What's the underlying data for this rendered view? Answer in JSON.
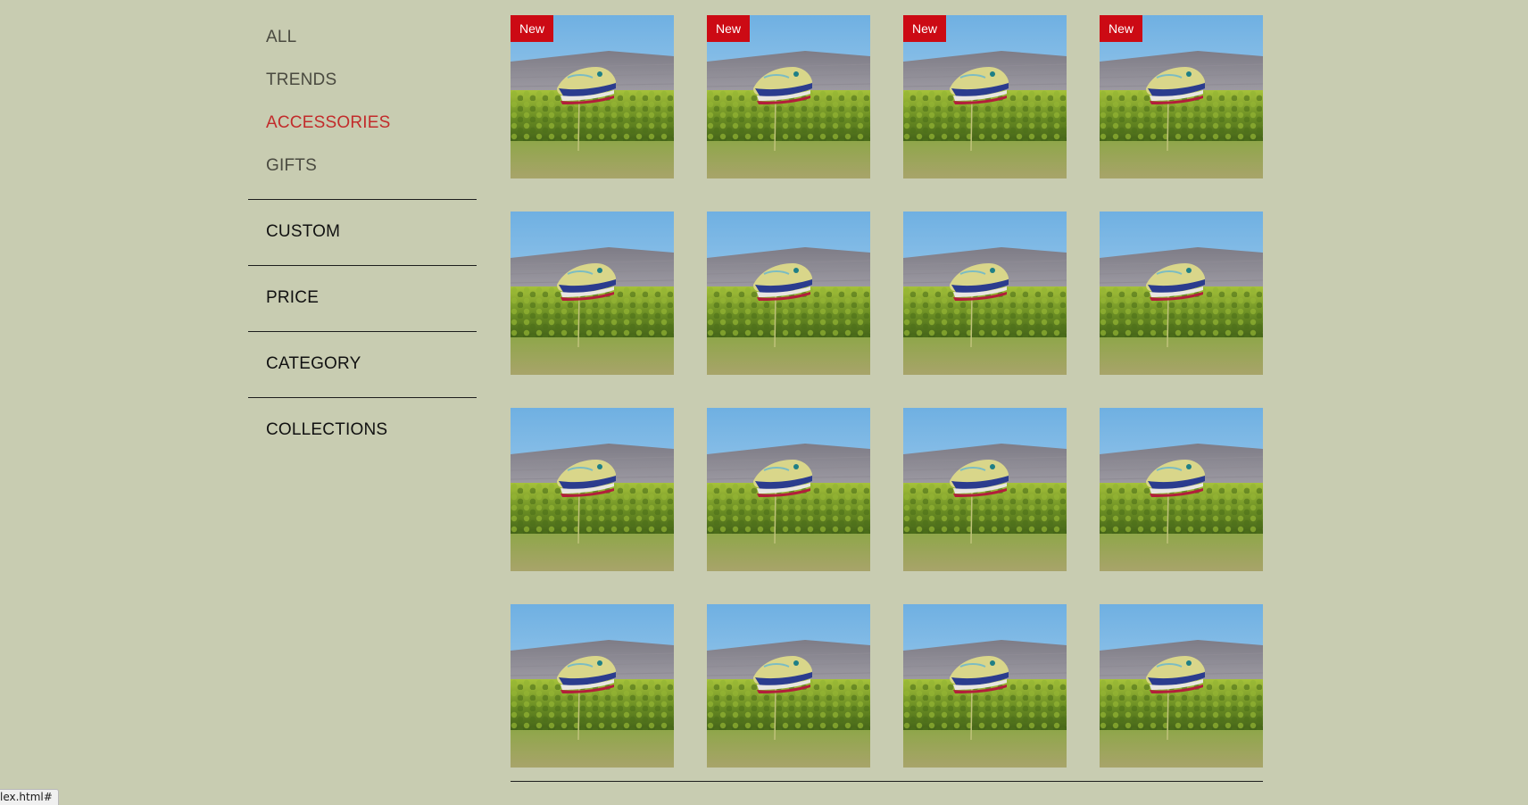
{
  "sidebar": {
    "nav": [
      {
        "label": "ALL",
        "active": false
      },
      {
        "label": "TRENDS",
        "active": false
      },
      {
        "label": "ACCESSORIES",
        "active": true
      },
      {
        "label": "GIFTS",
        "active": false
      }
    ],
    "filters": [
      {
        "label": "CUSTOM"
      },
      {
        "label": "PRICE"
      },
      {
        "label": "CATEGORY"
      },
      {
        "label": "COLLECTIONS"
      }
    ]
  },
  "products": [
    {
      "badge": "New"
    },
    {
      "badge": "New"
    },
    {
      "badge": "New"
    },
    {
      "badge": "New"
    },
    {
      "badge": null
    },
    {
      "badge": null
    },
    {
      "badge": null
    },
    {
      "badge": null
    },
    {
      "badge": null
    },
    {
      "badge": null
    },
    {
      "badge": null
    },
    {
      "badge": null
    },
    {
      "badge": null
    },
    {
      "badge": null
    },
    {
      "badge": null
    },
    {
      "badge": null
    }
  ],
  "status_bar": {
    "url": "lex.html#"
  },
  "colors": {
    "background": "#c8ccb1",
    "accent": "#c22b2b",
    "badge": "#cc0a14",
    "divider": "#1d1d1d"
  },
  "icons": {
    "product_image": "sneaker-photo-icon"
  }
}
